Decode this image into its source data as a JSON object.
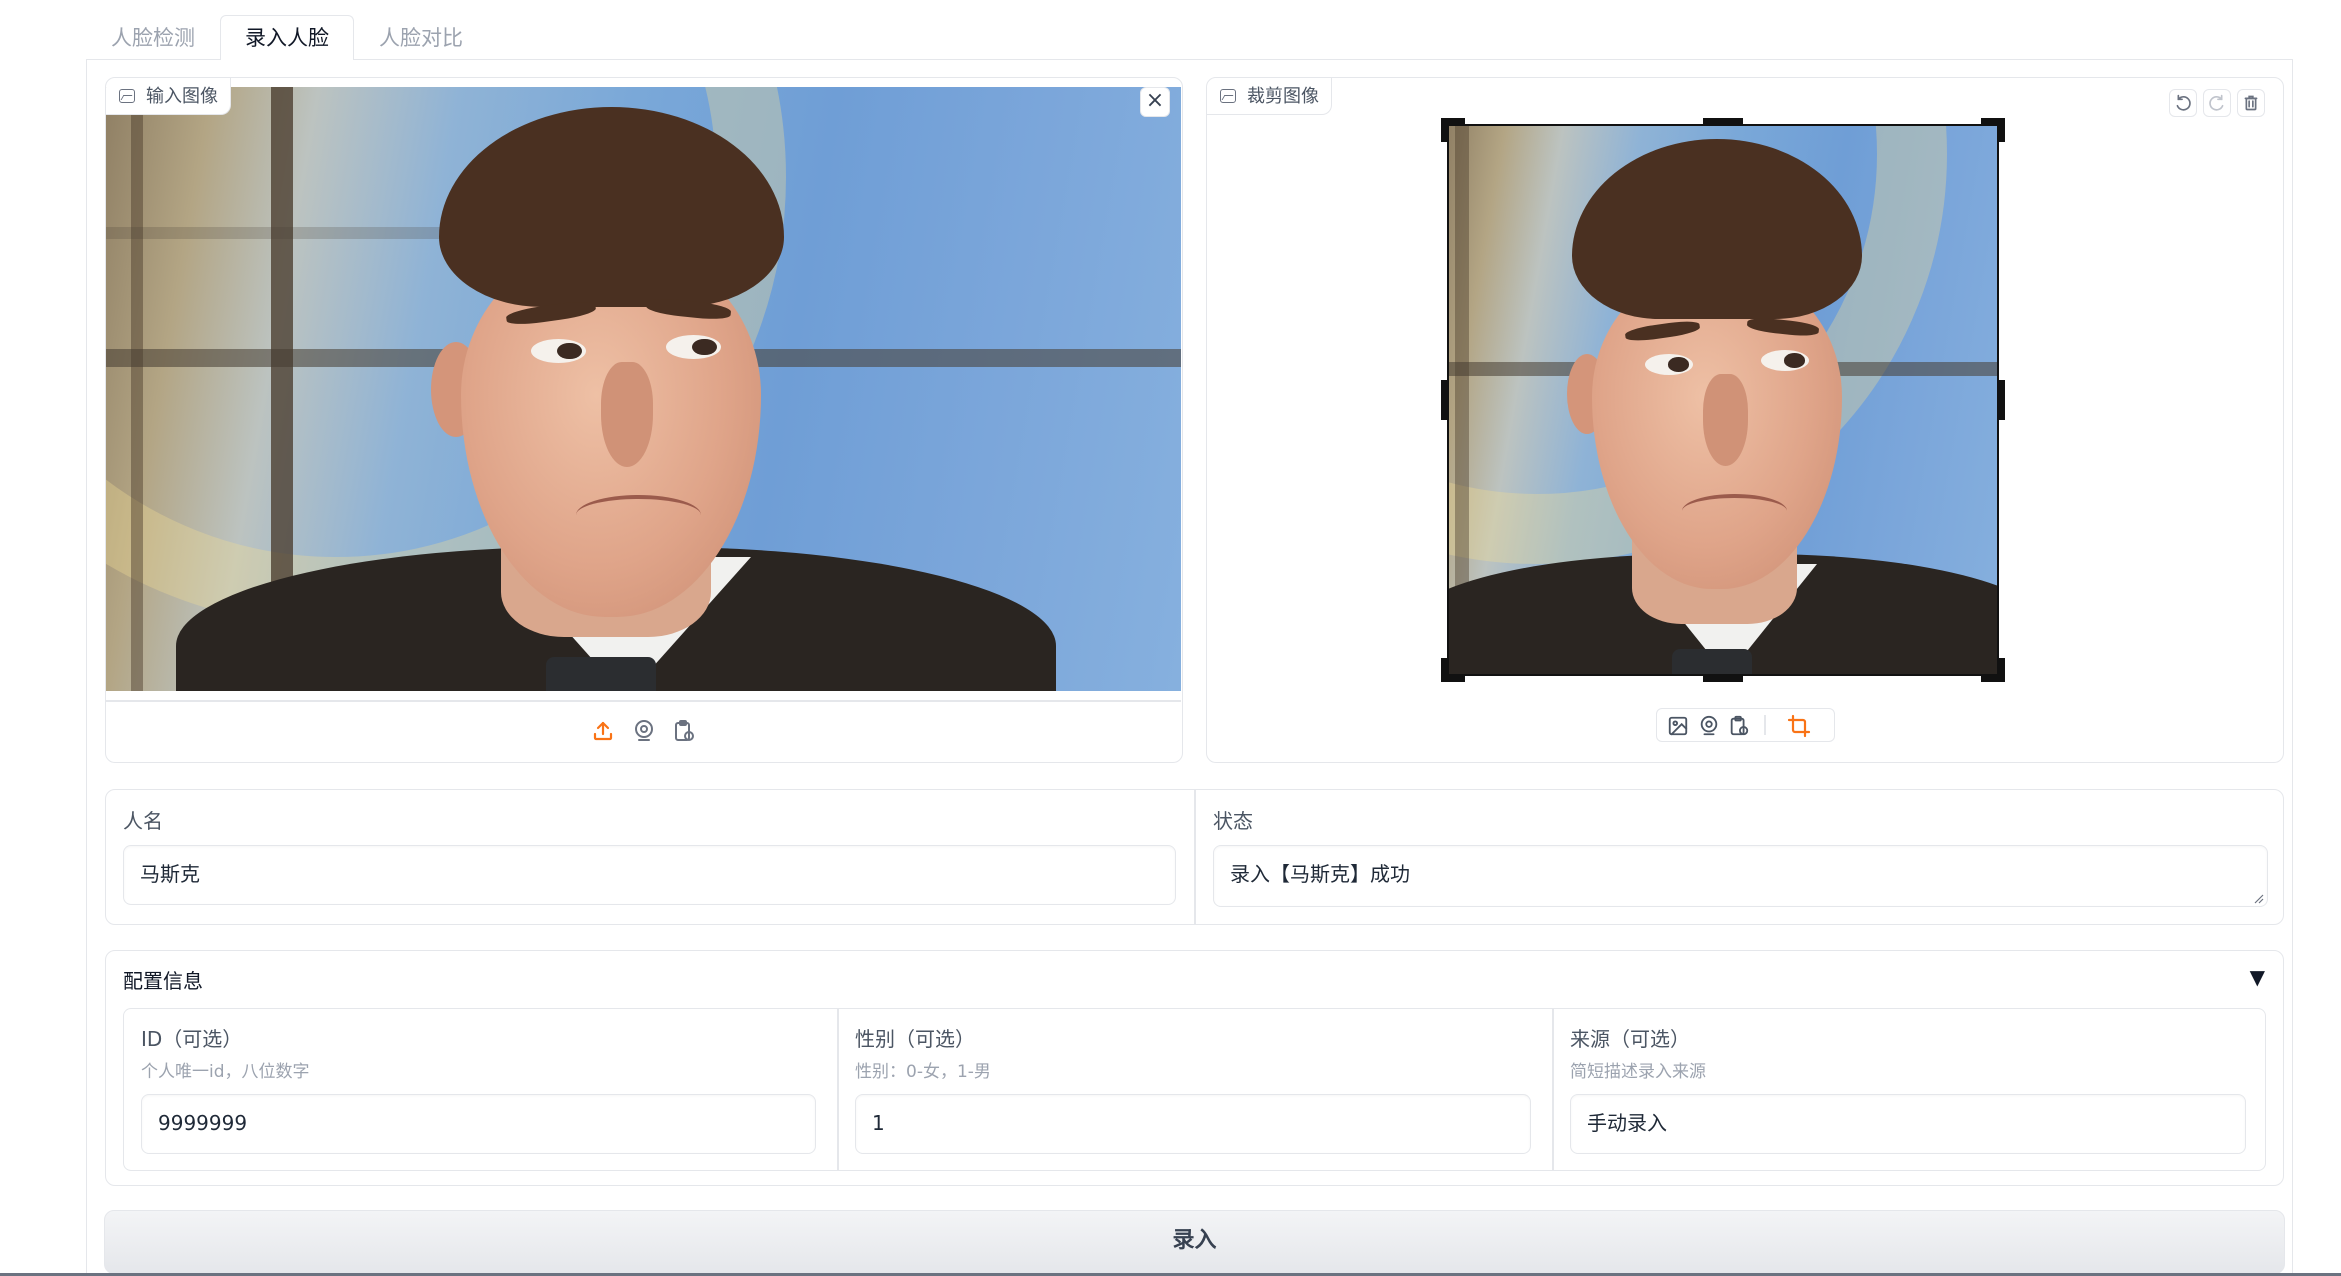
{
  "tabs": [
    {
      "label": "人脸检测",
      "active": false
    },
    {
      "label": "录入人脸",
      "active": true
    },
    {
      "label": "人脸对比",
      "active": false
    }
  ],
  "input_panel": {
    "label": "输入图像",
    "close_icon": "×",
    "toolbar": [
      "upload-icon",
      "webcam-icon",
      "clipboard-icon"
    ]
  },
  "crop_panel": {
    "label": "裁剪图像",
    "actions": [
      "undo-icon",
      "redo-icon",
      "delete-icon"
    ],
    "toolbar": [
      "image-icon",
      "webcam-icon",
      "clipboard-icon",
      "crop-icon"
    ]
  },
  "name_field": {
    "label": "人名",
    "value": "马斯克"
  },
  "status_field": {
    "label": "状态",
    "value": "录入【马斯克】成功"
  },
  "config": {
    "title": "配置信息",
    "toggle": "▼",
    "fields": [
      {
        "label": "ID（可选）",
        "hint": "个人唯一id，八位数字",
        "value": "9999999"
      },
      {
        "label": "性别（可选）",
        "hint": "性别：0-女，1-男",
        "value": "1"
      },
      {
        "label": "来源（可选）",
        "hint": "简短描述录入来源",
        "value": "手动录入"
      }
    ]
  },
  "submit": {
    "label": "录入"
  },
  "colors": {
    "accent": "#f97316",
    "border": "#e5e7eb",
    "text": "#1f2937"
  }
}
